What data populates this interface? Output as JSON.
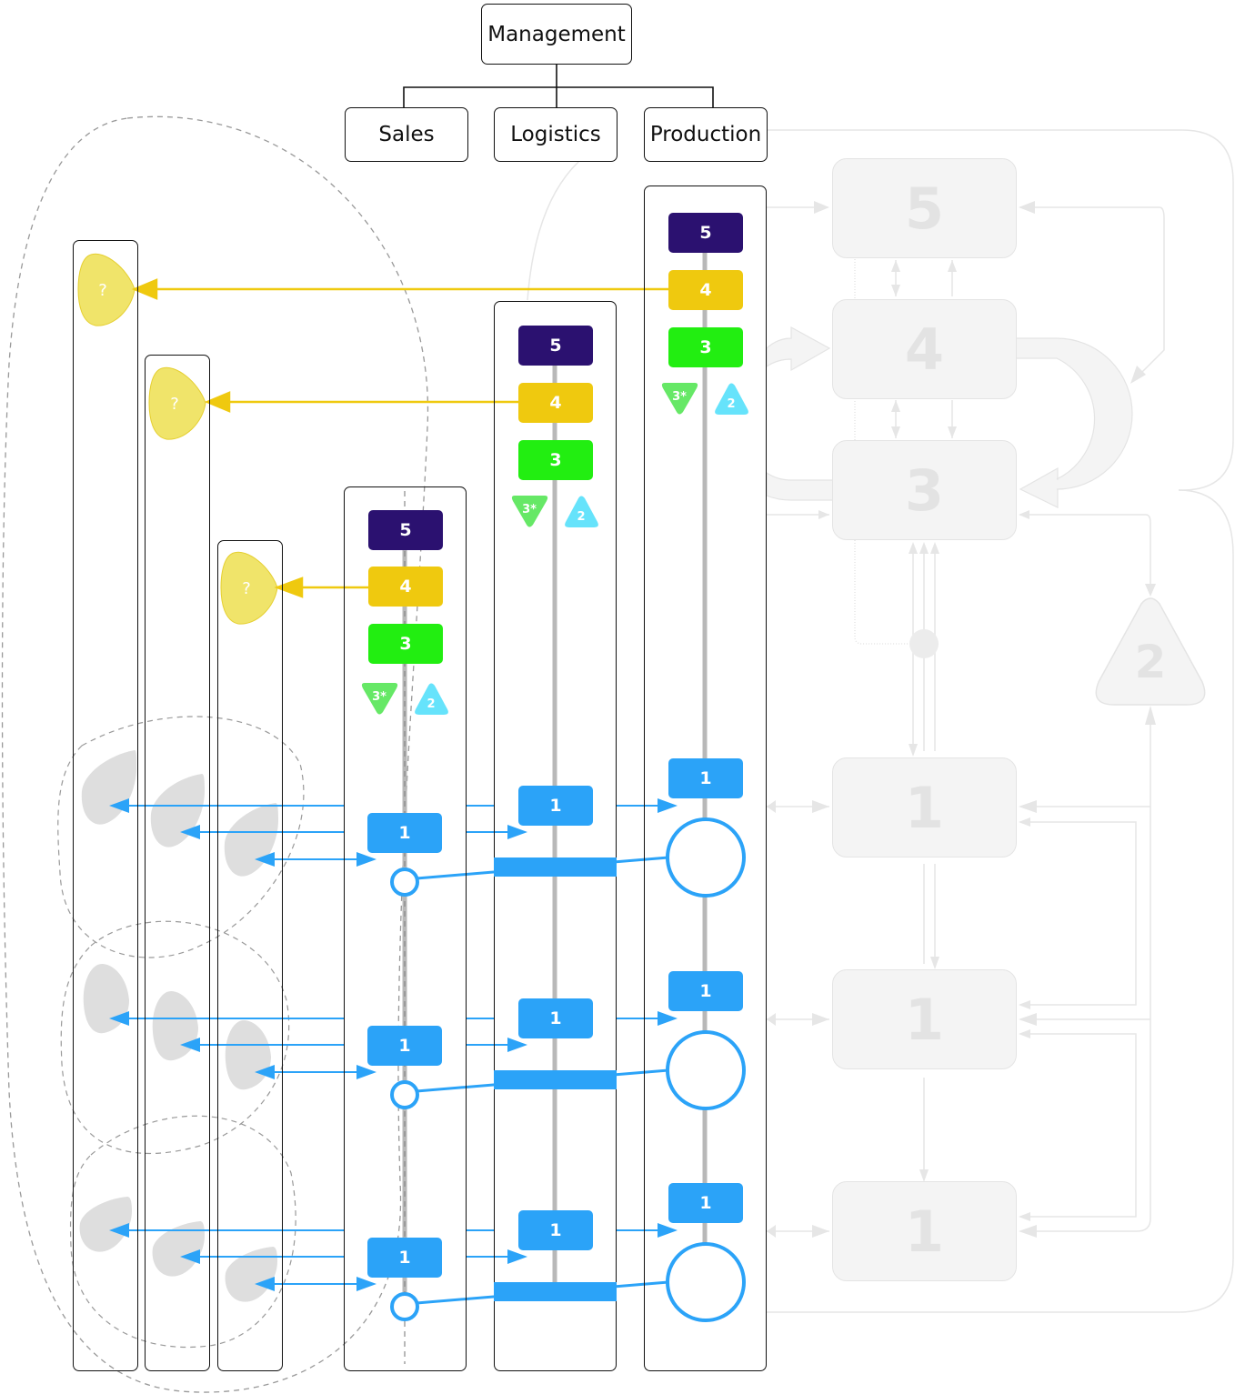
{
  "org_chart": {
    "root": "Management",
    "children": [
      "Sales",
      "Logistics",
      "Production"
    ]
  },
  "units": [
    {
      "name": "Sales",
      "badges": {
        "s5": "5",
        "s4": "4",
        "s3": "3",
        "s3star": "3*",
        "s2": "2"
      }
    },
    {
      "name": "Logistics",
      "badges": {
        "s5": "5",
        "s4": "4",
        "s3": "3",
        "s3star": "3*",
        "s2": "2"
      }
    },
    {
      "name": "Production",
      "badges": {
        "s5": "5",
        "s4": "4",
        "s3": "3",
        "s3star": "3*",
        "s2": "2"
      }
    }
  ],
  "operations_label": "1",
  "unknown_label": "?",
  "ghost_model": {
    "system5": "5",
    "system4": "4",
    "system3": "3",
    "system2": "2",
    "system1": [
      "1",
      "1",
      "1"
    ]
  },
  "colors": {
    "system5": "#2b1170",
    "system4": "#efc90f",
    "system3": "#22ee11",
    "system3star": "#66e866",
    "system2": "#66e3fb",
    "system1": "#2ba3f8",
    "unknown": "#f0e46a",
    "ghost": "#f4f4f4"
  }
}
